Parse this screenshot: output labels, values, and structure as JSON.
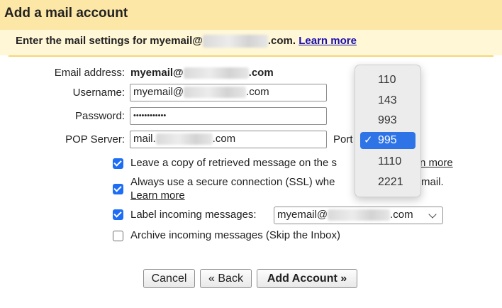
{
  "header": {
    "title": "Add a mail account",
    "instruction_prefix": "Enter the mail settings for myemail@",
    "instruction_suffix": ".com.",
    "learn_more": "Learn more"
  },
  "form": {
    "email_label": "Email address:",
    "email_prefix": "myemail@",
    "email_suffix": ".com",
    "username_label": "Username:",
    "username_prefix": "myemail@",
    "username_suffix": ".com",
    "password_label": "Password:",
    "password_value": "••••••••••••",
    "pop_label": "POP Server:",
    "pop_prefix": "mail.",
    "pop_suffix": ".com",
    "port_label": "Port"
  },
  "options": {
    "leave_copy": {
      "text": "Leave a copy of retrieved message on the s",
      "link": "n more",
      "checked": true
    },
    "ssl": {
      "line1": "Always use a secure connection (SSL) whe",
      "line1_end": "mail.",
      "link": "Learn more",
      "checked": true
    },
    "label_incoming": {
      "text": "Label incoming messages:",
      "select_prefix": "myemail@",
      "select_suffix": ".com",
      "checked": true
    },
    "archive": {
      "text": "Archive incoming messages (Skip the Inbox)",
      "checked": false
    }
  },
  "buttons": {
    "cancel": "Cancel",
    "back": "« Back",
    "add_account": "Add Account »"
  },
  "port_dropdown": {
    "options": [
      "110",
      "143",
      "993",
      "995",
      "1110",
      "2221"
    ],
    "selected": "995",
    "check_glyph": "✓"
  },
  "colors": {
    "header_bg": "#fce7a6",
    "accent_blue": "#1d6ef5",
    "link": "#1a0dab"
  }
}
